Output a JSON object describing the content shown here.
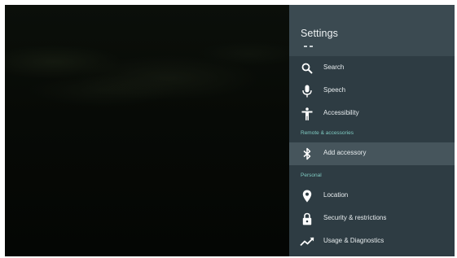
{
  "panel": {
    "title": "Settings",
    "items_top": [
      {
        "label": "Search",
        "icon": "search-icon"
      },
      {
        "label": "Speech",
        "icon": "microphone-icon"
      },
      {
        "label": "Accessibility",
        "icon": "accessibility-icon"
      }
    ],
    "section_remote": "Remote & accessories",
    "item_remote": {
      "label": "Add accessory",
      "icon": "bluetooth-icon",
      "selected": true
    },
    "section_personal": "Personal",
    "items_personal": [
      {
        "label": "Location",
        "icon": "location-pin-icon"
      },
      {
        "label": "Security & restrictions",
        "icon": "lock-icon"
      },
      {
        "label": "Usage & Diagnostics",
        "icon": "trending-icon"
      }
    ]
  },
  "colors": {
    "panel_bg": "#2e3c43",
    "header_bg": "#3b4a51",
    "selected_bg": "#46555c",
    "section_accent": "#7fc9c0"
  }
}
